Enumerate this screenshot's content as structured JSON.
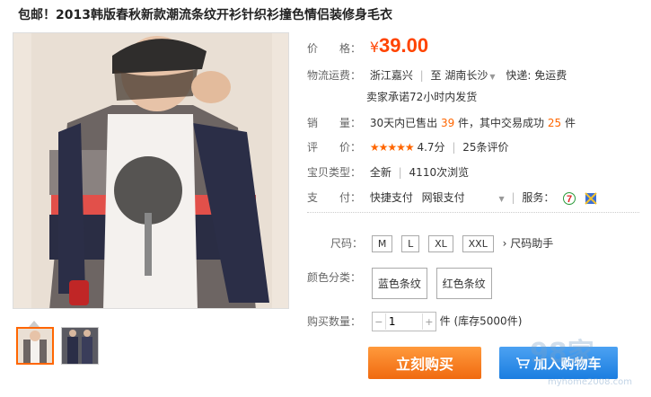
{
  "product": {
    "title": "包邮！2013韩版春秋新款潮流条纹开衫针织衫撞色情侣装修身毛衣"
  },
  "price": {
    "label": "价　　格：",
    "symbol": "¥",
    "value": "39.00"
  },
  "shipping": {
    "label": "物流运费：",
    "from": "浙江嘉兴",
    "to_prefix": "至",
    "to": "湖南长沙",
    "express": "快递: 免运费",
    "promise": "卖家承诺72小时内发货"
  },
  "sales": {
    "label": "销　　量：",
    "text_pre": "30天内已售出",
    "sold": "39",
    "text_mid": "件，其中交易成功",
    "success": "25",
    "text_post": "件"
  },
  "rating": {
    "label": "评　　价：",
    "stars": "★★★★★",
    "score": "4.7分",
    "reviews": "25条评价"
  },
  "item_type": {
    "label": "宝贝类型：",
    "condition": "全新",
    "views": "4110次浏览"
  },
  "payment": {
    "label": "支　　付：",
    "method1": "快捷支付",
    "method2": "网银支付",
    "service_label": "服务："
  },
  "size": {
    "label": "尺码：",
    "options": [
      "M",
      "L",
      "XL",
      "XXL"
    ],
    "helper": "尺码助手"
  },
  "color": {
    "label": "颜色分类：",
    "options": [
      "蓝色条纹",
      "红色条纹"
    ]
  },
  "quantity": {
    "label": "购买数量：",
    "value": "1",
    "stock": "件 (库存5000件)"
  },
  "actions": {
    "buy_now": "立刻购买",
    "add_cart": "加入购物车"
  },
  "watermark": {
    "main": "98家",
    "sub": "myhome2008.com"
  },
  "icons": {
    "service1": "seven-day-return-icon",
    "service2": "guarantee-icon",
    "cart": "cart-icon"
  },
  "colors": {
    "accent": "#ff4400",
    "buy": "#f47a1b",
    "cart": "#1b7ee0"
  }
}
